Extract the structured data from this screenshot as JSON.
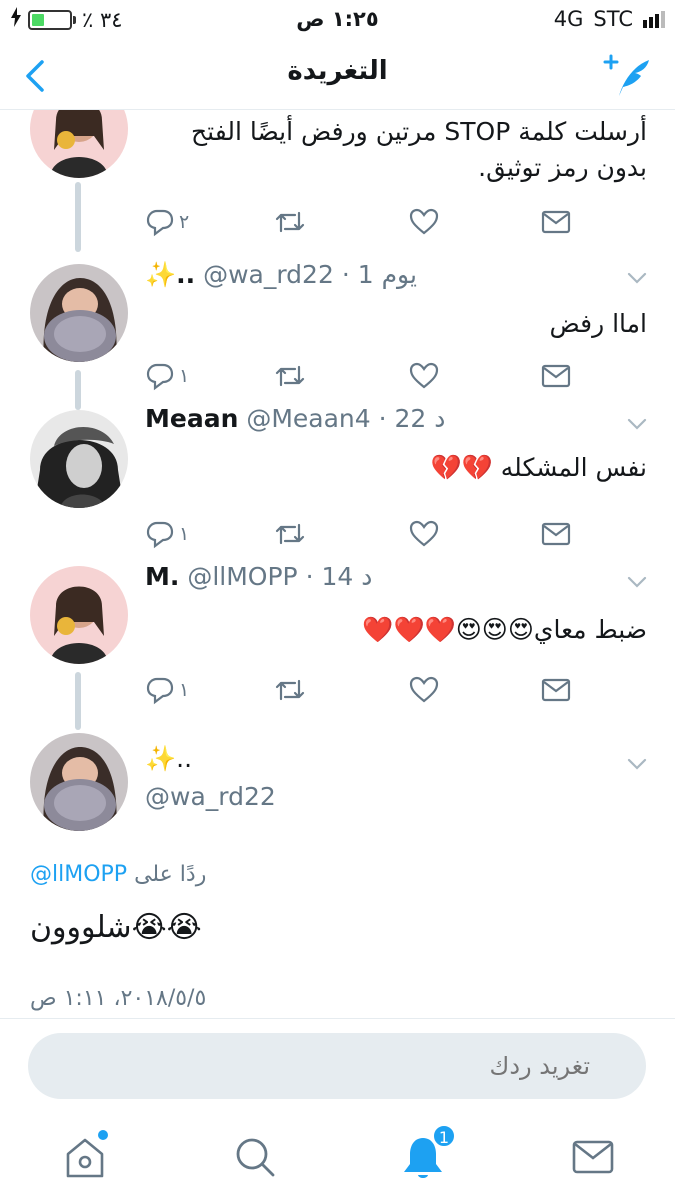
{
  "status": {
    "battery": "٣٤ ٪",
    "time": "١:٢٥ ص",
    "network": "4G",
    "carrier": "STC"
  },
  "nav": {
    "title": "التغريدة"
  },
  "tweets": [
    {
      "text": "أرسلت كلمة STOP مرتين ورفض أيضًا الفتح بدون رمز توثيق.",
      "reply_count": "٢"
    },
    {
      "name": "✨..",
      "handle": "@wa_rd22",
      "time": "· 1 يوم",
      "text": "اماا رفض",
      "reply_count": "١"
    },
    {
      "name": "Meaan",
      "handle": "@Meaan4",
      "time": "· 22 د",
      "text": "نفس المشكله 💔💔",
      "reply_count": "١"
    },
    {
      "name": "M.",
      "handle": "@llMOPP",
      "time": "· 14 د",
      "text": "ضبط معاي😍😍😍❤️❤️❤️",
      "reply_count": "١"
    }
  ],
  "main_tweet": {
    "name": "✨..",
    "handle": "@wa_rd22",
    "reply_label": "ردًا على",
    "reply_handle": "@llMOPP",
    "text": "شلووون😭😭",
    "timestamp": "٢٠١٨/٥/٥، ١:١١ ص"
  },
  "reply_bar": {
    "placeholder": "تغريد ردك"
  },
  "tabbar": {
    "notifications_badge": "1"
  },
  "colors": {
    "accent": "#1da1f2",
    "muted": "#657786",
    "divider": "#e6ecf0"
  }
}
